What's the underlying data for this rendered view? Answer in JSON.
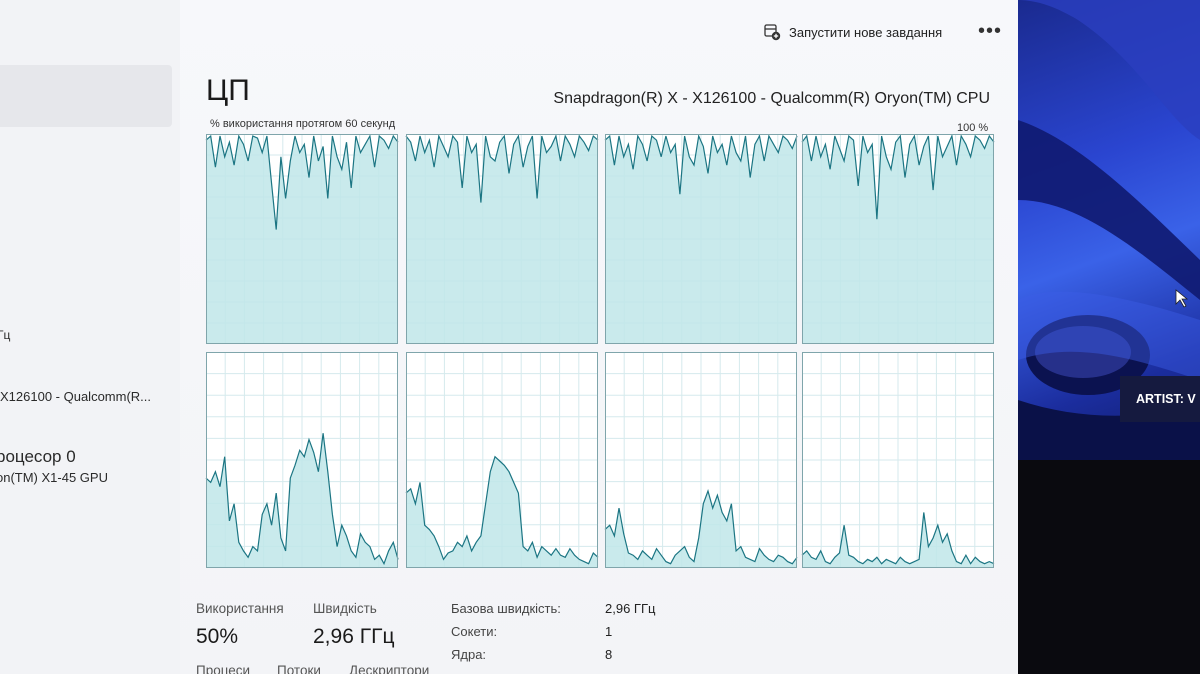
{
  "toolbar": {
    "new_task_label": "Запустити нове завдання",
    "more_label": "•••"
  },
  "sidebar": {
    "items": [
      {
        "text": "Гц"
      },
      {
        "text": "X126100 - Qualcomm(R..."
      },
      {
        "text": "роцесор 0"
      },
      {
        "text": "on(TM) X1-45 GPU"
      }
    ]
  },
  "header": {
    "title": "ЦП",
    "cpu_name": "Snapdragon(R) X - X126100 - Qualcomm(R) Oryon(TM) CPU",
    "util_label": "% використання протягом 60 секунд",
    "max_label": "100 %"
  },
  "colors": {
    "graph_fill": "#bfe6e9",
    "graph_line": "#1b7583",
    "graph_border": "#7fa5ab",
    "grid": "#d5eaed"
  },
  "cores": [
    {
      "values": [
        98,
        100,
        85,
        100,
        90,
        97,
        86,
        100,
        96,
        88,
        100,
        99,
        92,
        100,
        77,
        55,
        90,
        70,
        88,
        100,
        92,
        96,
        80,
        100,
        88,
        95,
        70,
        100,
        90,
        84,
        97,
        75,
        100,
        92,
        96,
        100,
        85,
        100,
        98,
        94,
        100,
        97
      ]
    },
    {
      "values": [
        100,
        97,
        88,
        100,
        92,
        98,
        85,
        100,
        95,
        90,
        100,
        97,
        75,
        100,
        92,
        96,
        68,
        100,
        90,
        88,
        97,
        100,
        82,
        96,
        100,
        85,
        95,
        100,
        70,
        100,
        92,
        95,
        100,
        88,
        100,
        96,
        90,
        100,
        97,
        93,
        100,
        98
      ]
    },
    {
      "values": [
        98,
        100,
        86,
        100,
        90,
        96,
        84,
        100,
        96,
        88,
        100,
        98,
        90,
        100,
        92,
        96,
        72,
        100,
        90,
        86,
        100,
        95,
        82,
        100,
        92,
        96,
        86,
        100,
        92,
        88,
        100,
        80,
        96,
        100,
        88,
        100,
        96,
        92,
        100,
        98,
        94,
        100
      ]
    },
    {
      "values": [
        97,
        100,
        88,
        100,
        90,
        96,
        84,
        100,
        94,
        88,
        100,
        98,
        76,
        100,
        92,
        96,
        60,
        100,
        90,
        84,
        97,
        100,
        80,
        96,
        100,
        86,
        95,
        100,
        74,
        100,
        90,
        95,
        100,
        86,
        100,
        96,
        90,
        100,
        98,
        94,
        100,
        97
      ]
    },
    {
      "values": [
        42,
        40,
        45,
        38,
        52,
        22,
        30,
        12,
        8,
        5,
        10,
        8,
        25,
        30,
        20,
        35,
        14,
        8,
        42,
        48,
        55,
        52,
        60,
        54,
        45,
        63,
        45,
        25,
        10,
        20,
        15,
        8,
        5,
        16,
        12,
        10,
        4,
        6,
        2,
        8,
        12,
        4
      ]
    },
    {
      "values": [
        35,
        37,
        30,
        40,
        20,
        18,
        15,
        10,
        4,
        7,
        8,
        12,
        10,
        15,
        8,
        12,
        15,
        30,
        45,
        52,
        50,
        48,
        45,
        40,
        35,
        10,
        8,
        12,
        5,
        10,
        8,
        6,
        9,
        6,
        5,
        9,
        6,
        4,
        3,
        2,
        7,
        5
      ]
    },
    {
      "values": [
        18,
        20,
        15,
        28,
        16,
        7,
        6,
        4,
        8,
        6,
        4,
        9,
        6,
        3,
        2,
        6,
        8,
        10,
        5,
        3,
        14,
        30,
        36,
        28,
        34,
        26,
        22,
        30,
        8,
        10,
        5,
        4,
        3,
        9,
        6,
        4,
        3,
        6,
        5,
        3,
        2,
        5
      ]
    },
    {
      "values": [
        6,
        8,
        5,
        4,
        8,
        3,
        2,
        5,
        7,
        20,
        6,
        5,
        3,
        2,
        4,
        3,
        5,
        2,
        4,
        3,
        2,
        5,
        3,
        2,
        3,
        4,
        26,
        10,
        14,
        20,
        12,
        16,
        8,
        3,
        2,
        6,
        2,
        5,
        3,
        2,
        3,
        2
      ]
    }
  ],
  "stats": {
    "usage_label": "Використання",
    "usage_value": "50%",
    "speed_label": "Швидкість",
    "speed_value": "2,96 ГГц",
    "processes_label": "Процеси",
    "threads_label": "Потоки",
    "handles_label": "Дескриптори"
  },
  "info": [
    {
      "label": "Базова швидкість:",
      "value": "2,96 ГГц"
    },
    {
      "label": "Сокети:",
      "value": "1"
    },
    {
      "label": "Ядра:",
      "value": "8"
    }
  ],
  "overlay": {
    "artist_text": "ARTIST: V"
  }
}
